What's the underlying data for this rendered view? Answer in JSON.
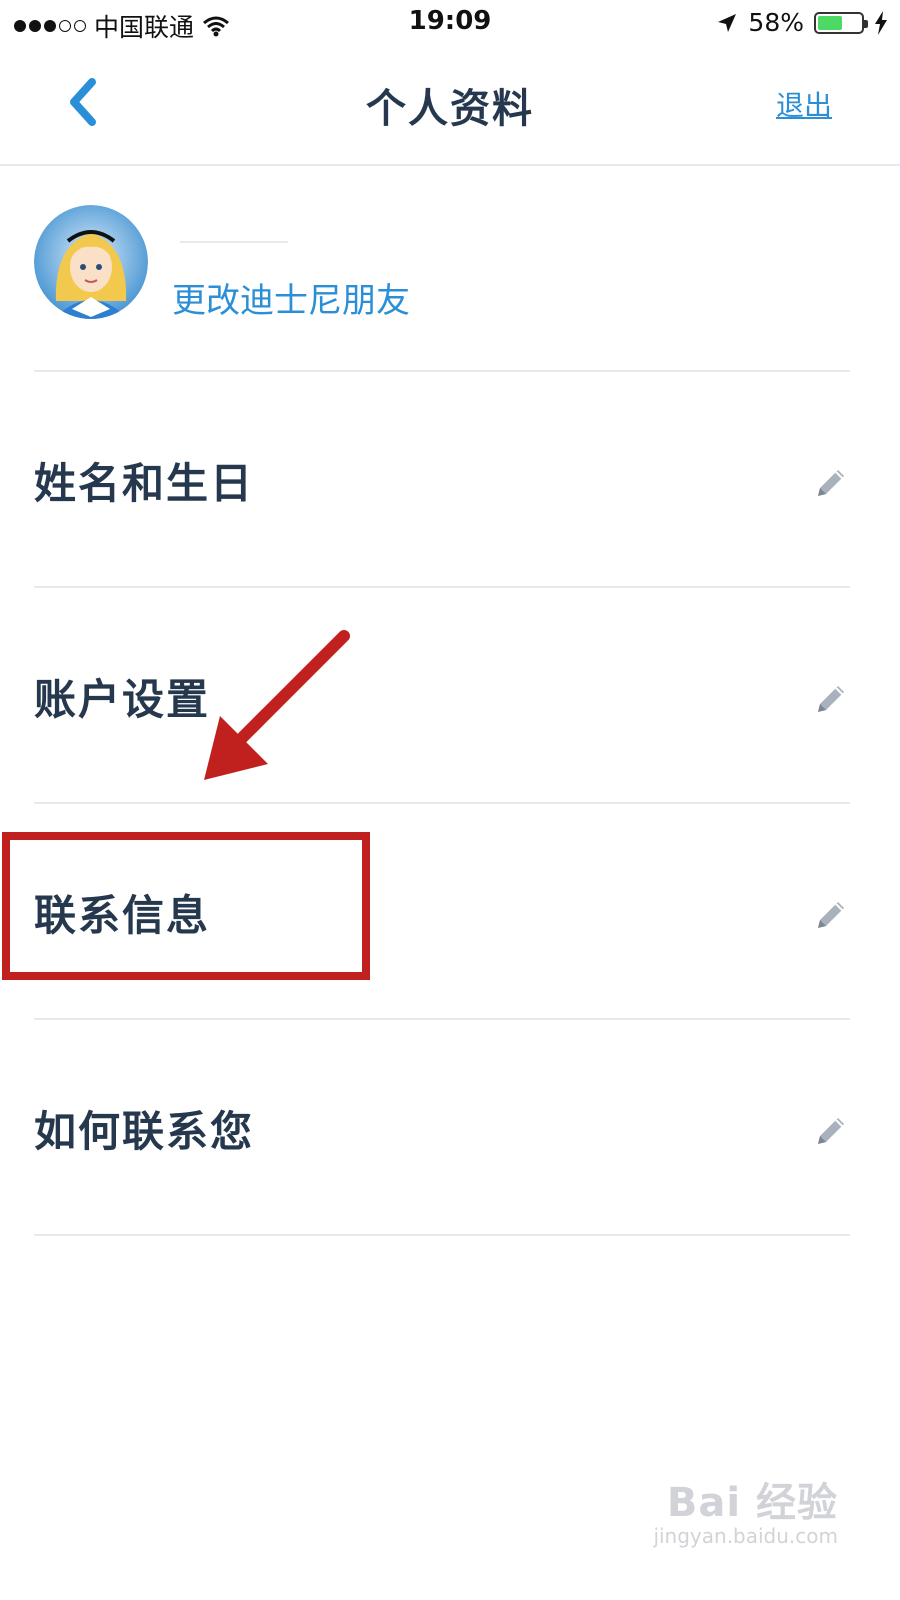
{
  "status_bar": {
    "carrier": "中国联通",
    "time": "19:09",
    "battery_percent": "58%",
    "battery_level": 0.58,
    "signal_bars_filled": 3,
    "signal_bars_total": 5
  },
  "nav": {
    "title": "个人资料",
    "logout_label": "退出",
    "back_icon": "chevron-left-icon"
  },
  "profile": {
    "change_friend_label": "更改迪士尼朋友"
  },
  "rows": [
    {
      "label": "姓名和生日",
      "icon": "pencil-icon"
    },
    {
      "label": "账户设置",
      "icon": "pencil-icon"
    },
    {
      "label": "联系信息",
      "icon": "pencil-icon"
    },
    {
      "label": "如何联系您",
      "icon": "pencil-icon"
    }
  ],
  "colors": {
    "accent": "#2a8fd6",
    "text": "#26384d",
    "annotation": "#c0201e",
    "divider": "#e6e9ee"
  },
  "watermark": {
    "main": "Bai 经验",
    "sub": "jingyan.baidu.com"
  }
}
